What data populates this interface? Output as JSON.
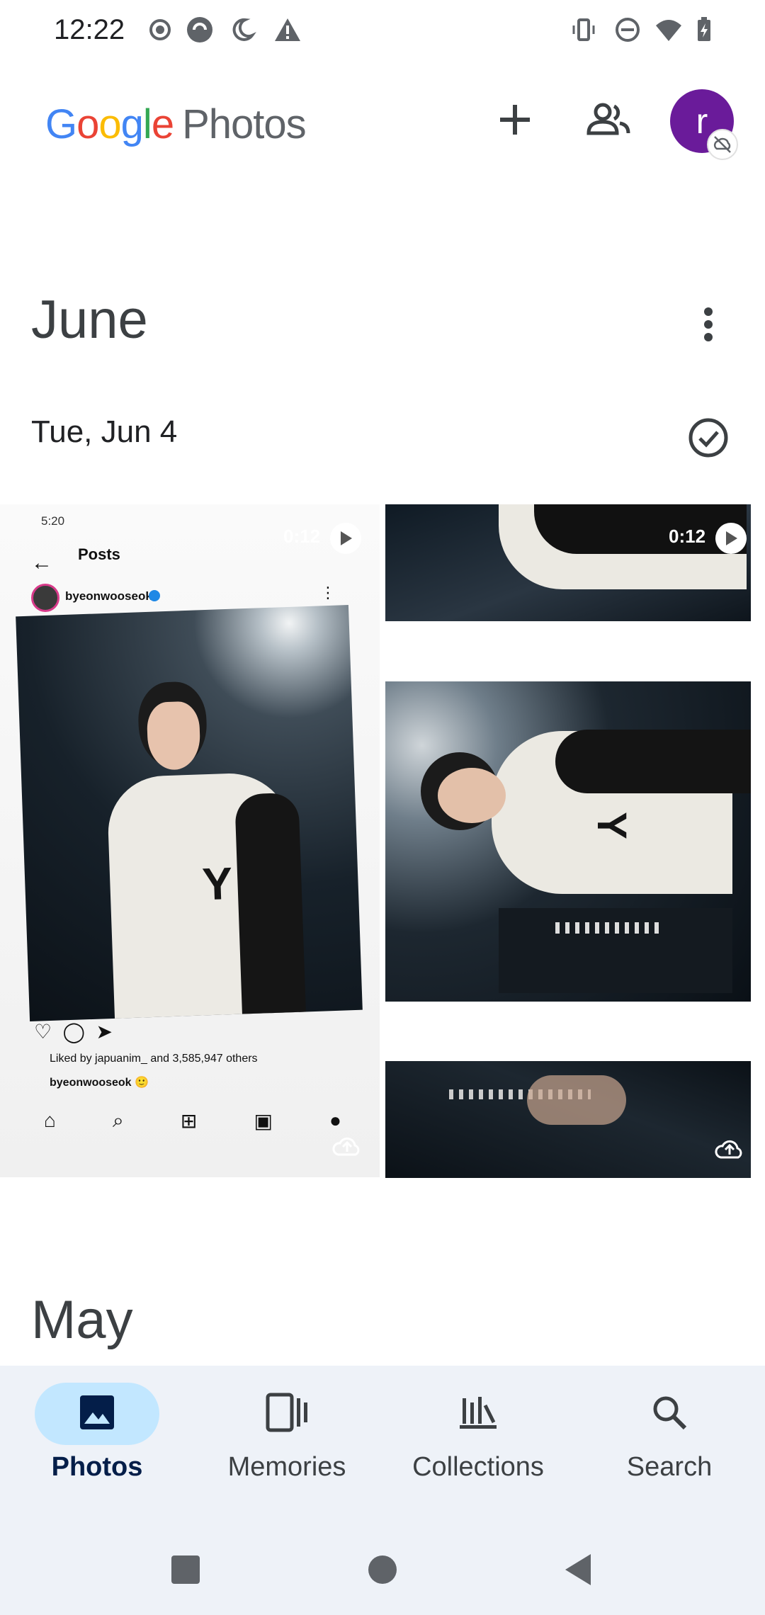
{
  "status_bar": {
    "time": "12:22",
    "left_icons": [
      "record-icon",
      "vpn-icon",
      "do-not-disturb-moon-icon",
      "alert-icon"
    ],
    "right_icons": [
      "vibrate-icon",
      "dnd-icon",
      "wifi-icon",
      "battery-charging-icon"
    ]
  },
  "app_bar": {
    "logo_letters": [
      "G",
      "o",
      "o",
      "g",
      "l",
      "e"
    ],
    "logo_suffix": "Photos",
    "add_icon": "plus-icon",
    "sharing_icon": "people-icon",
    "avatar_letter": "r",
    "avatar_color": "#6a1b9a",
    "avatar_badge_icon": "backup-off-icon"
  },
  "sections": [
    {
      "month": "June",
      "date": "Tue, Jun 4"
    },
    {
      "month": "May"
    }
  ],
  "grid": {
    "main_tile": {
      "duration": "0:12",
      "inner": {
        "status_time": "5:20",
        "title": "Posts",
        "username": "byeonwooseok",
        "likes_text": "Liked by japuanim_ and 3,585,947 others",
        "caption_user": "byeonwooseok 🙂"
      }
    },
    "right_top_tile": {
      "duration": "0:12"
    }
  },
  "bottom_nav": {
    "items": [
      {
        "label": "Photos",
        "icon": "photo-icon",
        "active": true
      },
      {
        "label": "Memories",
        "icon": "memories-icon",
        "active": false
      },
      {
        "label": "Collections",
        "icon": "collections-icon",
        "active": false
      },
      {
        "label": "Search",
        "icon": "search-icon",
        "active": false
      }
    ]
  },
  "system_nav": [
    "recents-square-icon",
    "home-circle-icon",
    "back-triangle-icon"
  ],
  "colors": {
    "accent_pill": "#c2e7ff",
    "nav_background": "#eef2f8"
  }
}
